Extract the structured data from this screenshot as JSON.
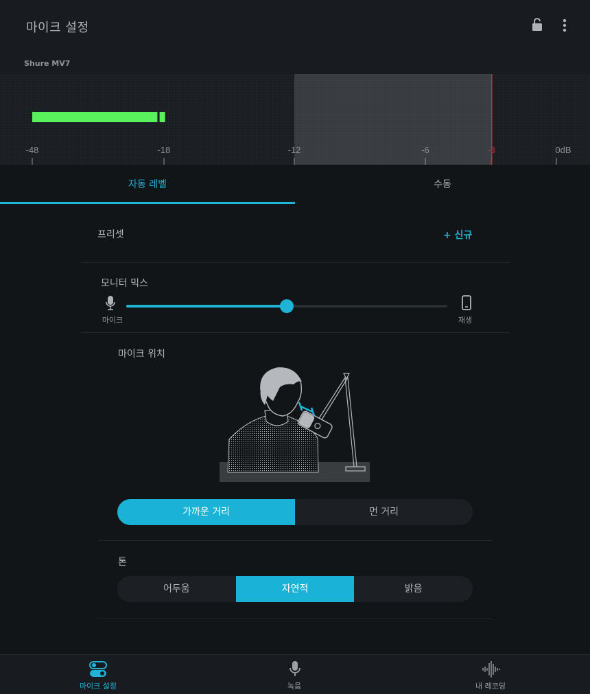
{
  "header": {
    "title": "마이크 설정",
    "device_name": "Shure MV7",
    "lock_icon": "lock-open-icon",
    "menu_icon": "more-vertical-icon"
  },
  "meter": {
    "scale_labels": [
      "-48",
      "-18",
      "-12",
      "-6",
      "-3",
      "0dB"
    ],
    "level_range_db": [
      -12,
      -3
    ],
    "limit_db": -3,
    "current_level_db": -19.5,
    "peak_db": -19,
    "colors": {
      "level": "#59f25c",
      "limit": "#c0303a",
      "range": "#3a3e42"
    }
  },
  "tabs": [
    {
      "label": "자동 레벨",
      "active": true
    },
    {
      "label": "수동",
      "active": false
    }
  ],
  "preset": {
    "label": "프리셋",
    "new_button": "+ 신규"
  },
  "monitor_mix": {
    "label": "모니터 믹스",
    "left_label": "마이크",
    "right_label": "재생",
    "left_icon": "microphone-icon",
    "right_icon": "phone-icon",
    "value_fraction": 0.5
  },
  "mic_position": {
    "label": "마이크 위치",
    "options": [
      "가까운 거리",
      "먼 거리"
    ],
    "selected": "가까운 거리"
  },
  "tone": {
    "label": "톤",
    "options": [
      "어두움",
      "자연적",
      "밝음"
    ],
    "selected": "자연적"
  },
  "bottom_nav": [
    {
      "label": "마이크 설정",
      "icon": "toggles-icon",
      "active": true
    },
    {
      "label": "녹음",
      "icon": "microphone-icon",
      "active": false
    },
    {
      "label": "내 레코딩",
      "icon": "waveform-icon",
      "active": false
    }
  ],
  "accent_color": "#21b3d6"
}
